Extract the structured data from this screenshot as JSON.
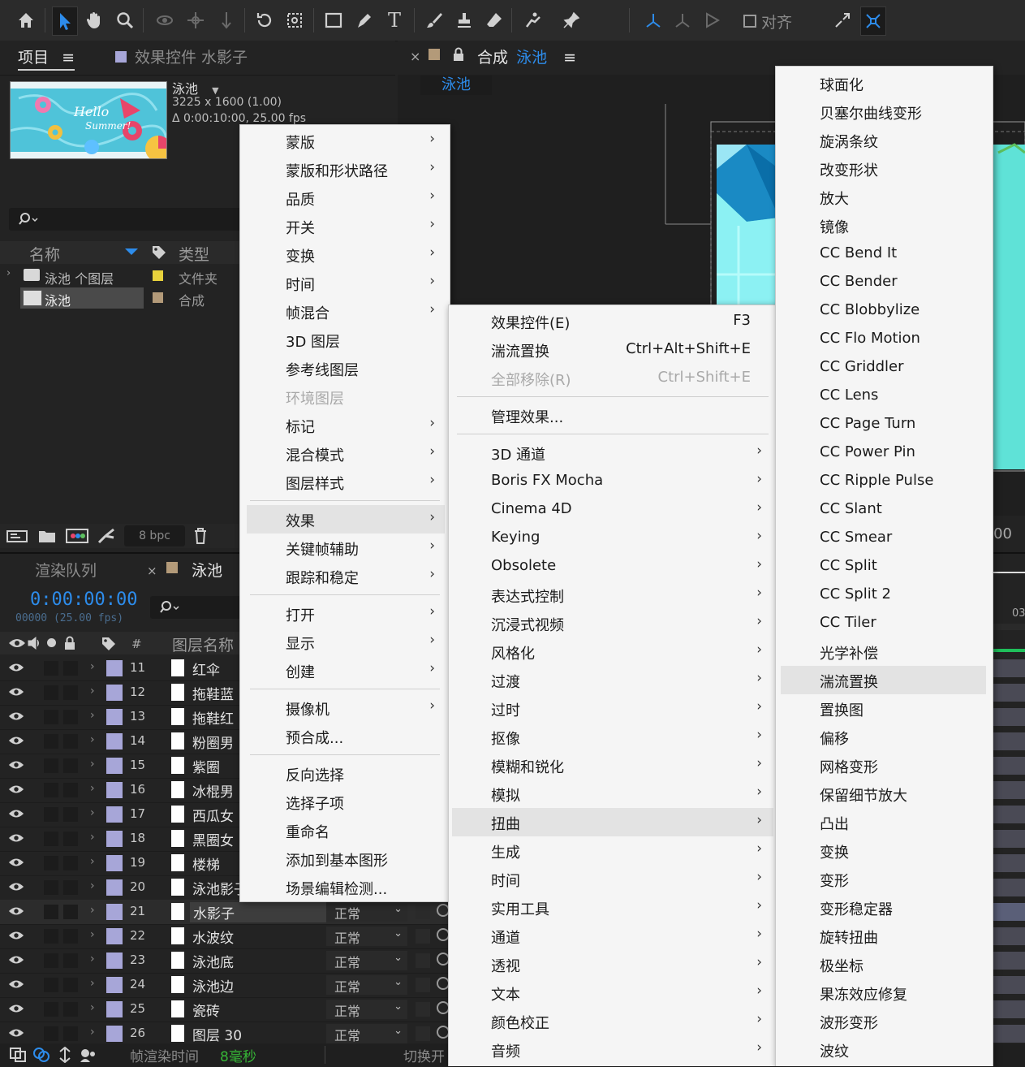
{
  "toolbar": {
    "align_label": "对齐"
  },
  "project_panel": {
    "tab_project": "项目",
    "tab_menu": "≡",
    "tab_effects": "效果控件 水影子",
    "comp_name": "泳池",
    "comp_dims": "3225 x 1600 (1.00)",
    "comp_duration": "Δ 0:00:10:00, 25.00 fps",
    "col_name": "名称",
    "col_type": "类型",
    "items": [
      {
        "name": "泳池 个图层",
        "type": "文件夹",
        "color": "#e8d23c"
      },
      {
        "name": "泳池",
        "type": "合成",
        "color": "#b39a79"
      }
    ],
    "bpc": "8 bpc"
  },
  "comp_panel": {
    "close": "×",
    "title_prefix": "合成",
    "title_name": "泳池",
    "tab_menu": "≡",
    "sub_tab": "泳池",
    "time_fragment": ":00"
  },
  "timeline": {
    "tab_render": "渲染队列",
    "tab_close": "×",
    "tab_comp": "泳池",
    "timecode": "0:00:00:00",
    "frame_info": "00000 (25.00 fps)",
    "col_hash": "#",
    "col_layer_name": "图层名称",
    "ruler_label": "03",
    "layers": [
      {
        "num": "11",
        "name": "红伞"
      },
      {
        "num": "12",
        "name": "拖鞋蓝"
      },
      {
        "num": "13",
        "name": "拖鞋红"
      },
      {
        "num": "14",
        "name": "粉圈男"
      },
      {
        "num": "15",
        "name": "紫圈"
      },
      {
        "num": "16",
        "name": "冰棍男"
      },
      {
        "num": "17",
        "name": "西瓜女"
      },
      {
        "num": "18",
        "name": "黑圈女"
      },
      {
        "num": "19",
        "name": "楼梯"
      },
      {
        "num": "20",
        "name": "泳池影子"
      },
      {
        "num": "21",
        "name": "水影子",
        "mode": "正常"
      },
      {
        "num": "22",
        "name": "水波纹",
        "mode": "正常"
      },
      {
        "num": "23",
        "name": "泳池底",
        "mode": "正常"
      },
      {
        "num": "24",
        "name": "泳池边",
        "mode": "正常"
      },
      {
        "num": "25",
        "name": "瓷砖",
        "mode": "正常"
      },
      {
        "num": "26",
        "name": "图层 30",
        "mode": "正常"
      }
    ],
    "render_time_label": "帧渲染时间",
    "render_time_value": "8毫秒",
    "toggle_label": "切换开"
  },
  "context_menu": {
    "items": [
      {
        "label": "蒙版",
        "sub": true
      },
      {
        "label": "蒙版和形状路径",
        "sub": true
      },
      {
        "label": "品质",
        "sub": true
      },
      {
        "label": "开关",
        "sub": true
      },
      {
        "label": "变换",
        "sub": true
      },
      {
        "label": "时间",
        "sub": true
      },
      {
        "label": "帧混合",
        "sub": true
      },
      {
        "label": "3D 图层",
        "sub": false
      },
      {
        "label": "参考线图层",
        "sub": false
      },
      {
        "label": "环境图层",
        "sub": false,
        "disabled": true
      },
      {
        "label": "标记",
        "sub": true
      },
      {
        "label": "混合模式",
        "sub": true
      },
      {
        "label": "图层样式",
        "sub": true
      },
      {
        "label": "效果",
        "sub": true,
        "highlighted": true
      },
      {
        "label": "关键帧辅助",
        "sub": true
      },
      {
        "label": "跟踪和稳定",
        "sub": true
      },
      {
        "label": "打开",
        "sub": true
      },
      {
        "label": "显示",
        "sub": true
      },
      {
        "label": "创建",
        "sub": true
      },
      {
        "label": "摄像机",
        "sub": true
      },
      {
        "label": "预合成...",
        "sub": false
      },
      {
        "label": "反向选择",
        "sub": false
      },
      {
        "label": "选择子项",
        "sub": false
      },
      {
        "label": "重命名",
        "sub": false
      },
      {
        "label": "添加到基本图形",
        "sub": false
      },
      {
        "label": "场景编辑检测...",
        "sub": false
      }
    ]
  },
  "effects_menu": {
    "top_items": [
      {
        "label": "效果控件(E)",
        "shortcut": "F3"
      },
      {
        "label": "湍流置换",
        "shortcut": "Ctrl+Alt+Shift+E"
      },
      {
        "label": "全部移除(R)",
        "shortcut": "Ctrl+Shift+E",
        "disabled": true
      }
    ],
    "manage": "管理效果...",
    "categories": [
      "3D 通道",
      "Boris FX Mocha",
      "Cinema 4D",
      "Keying",
      "Obsolete",
      "表达式控制",
      "沉浸式视频",
      "风格化",
      "过渡",
      "过时",
      "抠像",
      "模糊和锐化",
      "模拟",
      "扭曲",
      "生成",
      "时间",
      "实用工具",
      "通道",
      "透视",
      "文本",
      "颜色校正",
      "音频"
    ],
    "highlighted": "扭曲"
  },
  "distort_menu": {
    "items": [
      "球面化",
      "贝塞尔曲线变形",
      "旋涡条纹",
      "改变形状",
      "放大",
      "镜像",
      "CC Bend It",
      "CC Bender",
      "CC Blobbylize",
      "CC Flo Motion",
      "CC Griddler",
      "CC Lens",
      "CC Page Turn",
      "CC Power Pin",
      "CC Ripple Pulse",
      "CC Slant",
      "CC Smear",
      "CC Split",
      "CC Split 2",
      "CC Tiler",
      "光学补偿",
      "湍流置换",
      "置换图",
      "偏移",
      "网格变形",
      "保留细节放大",
      "凸出",
      "变换",
      "变形",
      "变形稳定器",
      "旋转扭曲",
      "极坐标",
      "果冻效应修复",
      "波形变形",
      "波纹"
    ],
    "highlighted": "湍流置换"
  },
  "colors": {
    "accent_blue": "#2d8ceb",
    "layer_label": "#a7a6d8",
    "menu_bg": "#f5f5f5"
  }
}
